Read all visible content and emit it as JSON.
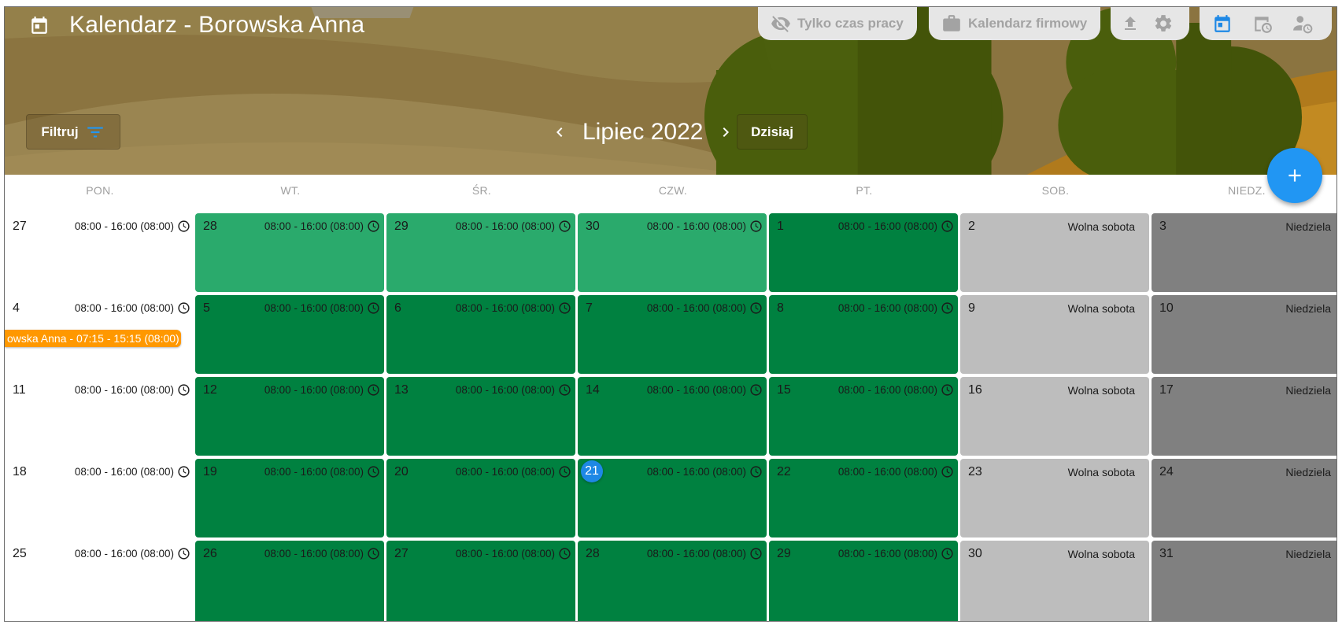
{
  "header": {
    "title": "Kalendarz - Borowska Anna",
    "worktime_label": "Tylko czas pracy",
    "company_label": "Kalendarz firmowy",
    "filter_label": "Filtruj",
    "month_label": "Lipiec 2022",
    "today_label": "Dzisiaj",
    "colors": {
      "accent": "#2196f3",
      "header_bg": "#8a7440"
    }
  },
  "weekdays": [
    "PON.",
    "WT.",
    "ŚR.",
    "CZW.",
    "PT.",
    "SOB.",
    "NIEDZ."
  ],
  "event": {
    "label": "owska Anna - 07:15 - 15:15 (08:00)",
    "color": "#ff9800"
  },
  "weeks": [
    [
      {
        "day": "27",
        "type": "first",
        "hours": "08:00 - 16:00 (08:00)"
      },
      {
        "day": "28",
        "type": "light",
        "hours": "08:00 - 16:00 (08:00)"
      },
      {
        "day": "29",
        "type": "light",
        "hours": "08:00 - 16:00 (08:00)"
      },
      {
        "day": "30",
        "type": "light",
        "hours": "08:00 - 16:00 (08:00)"
      },
      {
        "day": "1",
        "type": "dark",
        "hours": "08:00 - 16:00 (08:00)"
      },
      {
        "day": "2",
        "type": "sat",
        "label": "Wolna sobota"
      },
      {
        "day": "3",
        "type": "sun",
        "label": "Niedziela"
      }
    ],
    [
      {
        "day": "4",
        "type": "first",
        "hours": "08:00 - 16:00 (08:00)"
      },
      {
        "day": "5",
        "type": "dark",
        "hours": "08:00 - 16:00 (08:00)"
      },
      {
        "day": "6",
        "type": "dark",
        "hours": "08:00 - 16:00 (08:00)"
      },
      {
        "day": "7",
        "type": "dark",
        "hours": "08:00 - 16:00 (08:00)"
      },
      {
        "day": "8",
        "type": "dark",
        "hours": "08:00 - 16:00 (08:00)"
      },
      {
        "day": "9",
        "type": "sat",
        "label": "Wolna sobota"
      },
      {
        "day": "10",
        "type": "sun",
        "label": "Niedziela"
      }
    ],
    [
      {
        "day": "11",
        "type": "first",
        "hours": "08:00 - 16:00 (08:00)"
      },
      {
        "day": "12",
        "type": "dark",
        "hours": "08:00 - 16:00 (08:00)"
      },
      {
        "day": "13",
        "type": "dark",
        "hours": "08:00 - 16:00 (08:00)"
      },
      {
        "day": "14",
        "type": "dark",
        "hours": "08:00 - 16:00 (08:00)"
      },
      {
        "day": "15",
        "type": "dark",
        "hours": "08:00 - 16:00 (08:00)"
      },
      {
        "day": "16",
        "type": "sat",
        "label": "Wolna sobota"
      },
      {
        "day": "17",
        "type": "sun",
        "label": "Niedziela"
      }
    ],
    [
      {
        "day": "18",
        "type": "first",
        "hours": "08:00 - 16:00 (08:00)"
      },
      {
        "day": "19",
        "type": "dark",
        "hours": "08:00 - 16:00 (08:00)"
      },
      {
        "day": "20",
        "type": "dark",
        "hours": "08:00 - 16:00 (08:00)"
      },
      {
        "day": "21",
        "type": "dark",
        "hours": "08:00 - 16:00 (08:00)",
        "today": true
      },
      {
        "day": "22",
        "type": "dark",
        "hours": "08:00 - 16:00 (08:00)"
      },
      {
        "day": "23",
        "type": "sat",
        "label": "Wolna sobota"
      },
      {
        "day": "24",
        "type": "sun",
        "label": "Niedziela"
      }
    ],
    [
      {
        "day": "25",
        "type": "first",
        "hours": "08:00 - 16:00 (08:00)"
      },
      {
        "day": "26",
        "type": "dark",
        "hours": "08:00 - 16:00 (08:00)"
      },
      {
        "day": "27",
        "type": "dark",
        "hours": "08:00 - 16:00 (08:00)"
      },
      {
        "day": "28",
        "type": "dark",
        "hours": "08:00 - 16:00 (08:00)"
      },
      {
        "day": "29",
        "type": "dark",
        "hours": "08:00 - 16:00 (08:00)"
      },
      {
        "day": "30",
        "type": "sat",
        "label": "Wolna sobota"
      },
      {
        "day": "31",
        "type": "sun",
        "label": "Niedziela"
      }
    ]
  ]
}
